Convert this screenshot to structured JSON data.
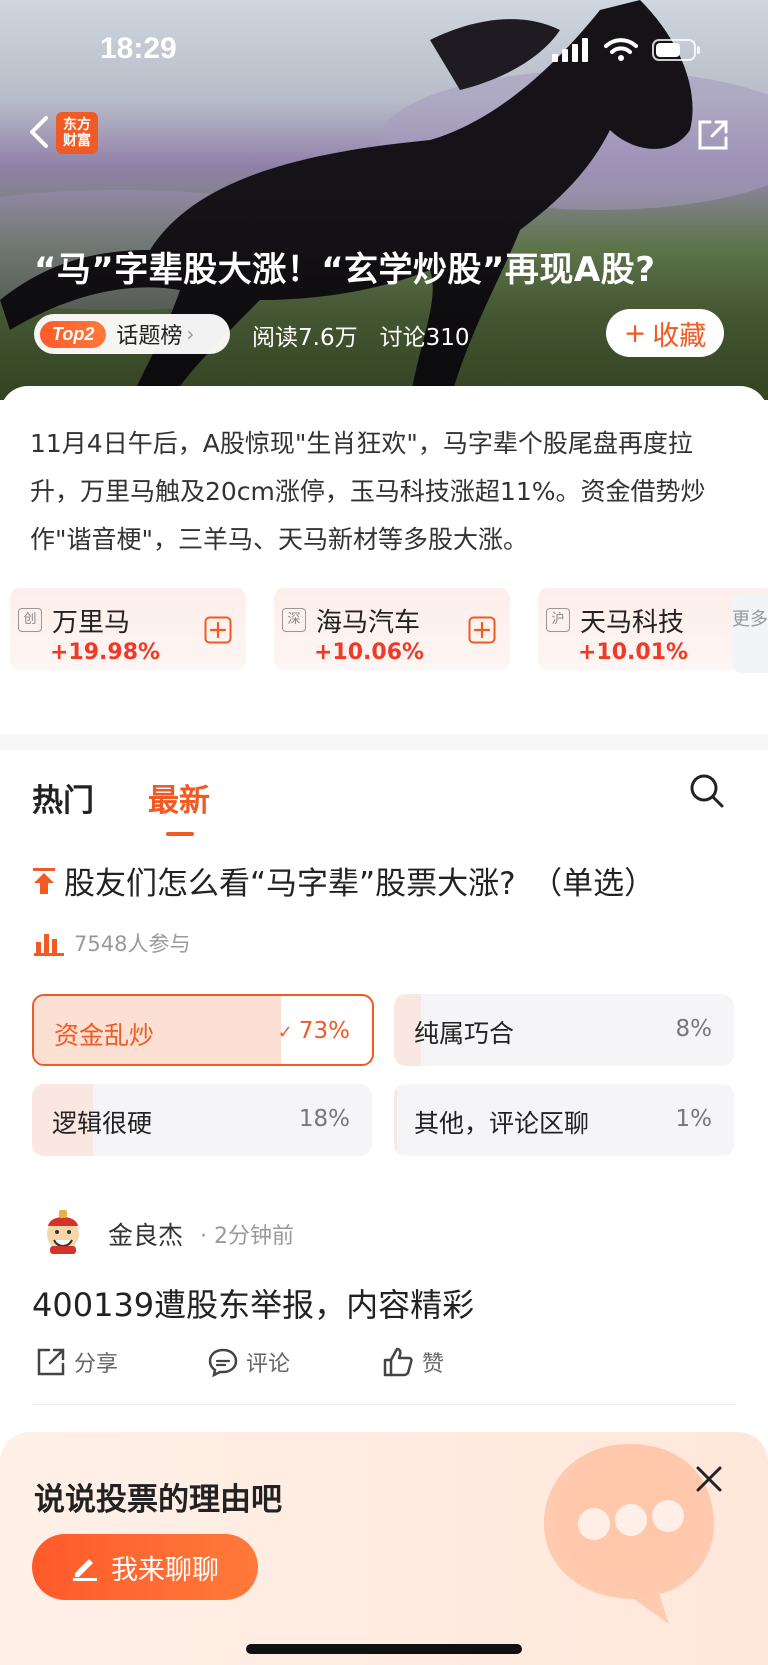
{
  "status_bar": {
    "time": "18:29"
  },
  "header": {
    "logo_line1": "东方",
    "logo_line2": "财富",
    "title": "“马”字辈股大涨！“玄学炒股”再现A股?",
    "rank_badge": "Top2",
    "rank_label": "话题榜",
    "reads": "阅读7.6万",
    "discussions": "讨论310",
    "favorite_label": "收藏"
  },
  "summary": "11月4日午后，A股惊现\"生肖狂欢\"，马字辈个股尾盘再度拉升，万里马触及20cm涨停，玉马科技涨超11%。资金借势炒作\"谐音梗\"，三羊马、天马新材等多股大涨。",
  "stocks": [
    {
      "exchange": "创",
      "name": "万里马",
      "change": "+19.98%"
    },
    {
      "exchange": "深",
      "name": "海马汽车",
      "change": "+10.06%"
    },
    {
      "exchange": "沪",
      "name": "天马科技",
      "change": "+10.01%"
    }
  ],
  "more_label": "更多",
  "tabs": [
    {
      "label": "热门"
    },
    {
      "label": "最新"
    }
  ],
  "poll": {
    "question": "股友们怎么看“马字辈”股票大涨?　（单选）",
    "participants": "7548人参与",
    "options": [
      {
        "label": "资金乱炒",
        "percent": "73%",
        "value": 0.73,
        "selected": true
      },
      {
        "label": "纯属巧合",
        "percent": "8%",
        "value": 0.08,
        "selected": false
      },
      {
        "label": "逻辑很硬",
        "percent": "18%",
        "value": 0.18,
        "selected": false
      },
      {
        "label": "其他，评论区聊",
        "percent": "1%",
        "value": 0.01,
        "selected": false
      }
    ]
  },
  "post": {
    "user": "金良杰",
    "time": "· 2分钟前",
    "text": "400139遭股东举报，内容精彩",
    "share": "分享",
    "comment": "评论",
    "like": "赞"
  },
  "prompt": {
    "title": "说说投票的理由吧",
    "button": "我来聊聊"
  },
  "colors": {
    "accent": "#f05a24",
    "up": "#ee3a26"
  }
}
